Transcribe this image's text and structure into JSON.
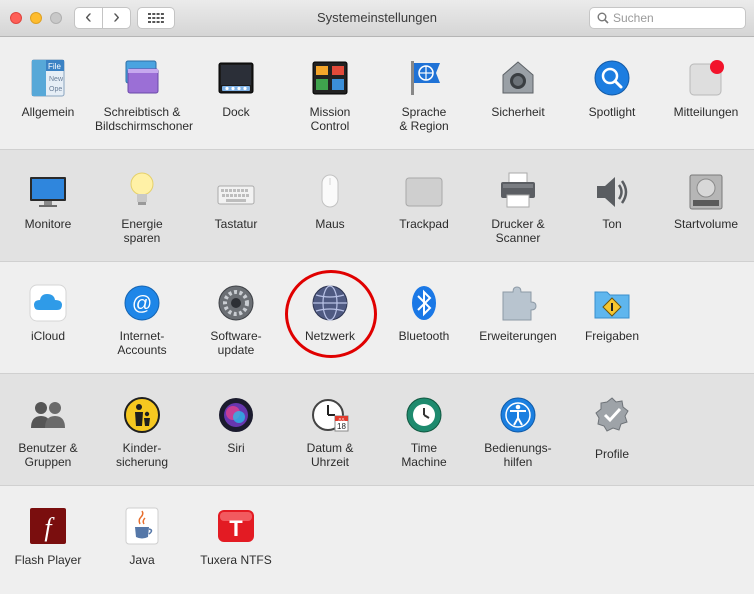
{
  "window": {
    "title": "Systemeinstellungen"
  },
  "toolbar": {
    "back_glyph": "‹",
    "forward_glyph": "›",
    "search_placeholder": "Suchen"
  },
  "rows": [
    [
      {
        "label": "Allgemein",
        "icon": "general-icon"
      },
      {
        "label": "Schreibtisch &\nBildschirmschoner",
        "icon": "desktop-icon"
      },
      {
        "label": "Dock",
        "icon": "dock-icon"
      },
      {
        "label": "Mission\nControl",
        "icon": "mission-control-icon"
      },
      {
        "label": "Sprache\n& Region",
        "icon": "language-region-icon"
      },
      {
        "label": "Sicherheit",
        "icon": "security-icon"
      },
      {
        "label": "Spotlight",
        "icon": "spotlight-icon"
      },
      {
        "label": "Mitteilungen",
        "icon": "notifications-icon"
      }
    ],
    [
      {
        "label": "Monitore",
        "icon": "display-icon"
      },
      {
        "label": "Energie\nsparen",
        "icon": "energy-saver-icon"
      },
      {
        "label": "Tastatur",
        "icon": "keyboard-icon"
      },
      {
        "label": "Maus",
        "icon": "mouse-icon"
      },
      {
        "label": "Trackpad",
        "icon": "trackpad-icon"
      },
      {
        "label": "Drucker &\nScanner",
        "icon": "printer-icon"
      },
      {
        "label": "Ton",
        "icon": "sound-icon"
      },
      {
        "label": "Startvolume",
        "icon": "startup-disk-icon"
      }
    ],
    [
      {
        "label": "iCloud",
        "icon": "icloud-icon"
      },
      {
        "label": "Internet-\nAccounts",
        "icon": "internet-accounts-icon"
      },
      {
        "label": "Software-\nupdate",
        "icon": "software-update-icon"
      },
      {
        "label": "Netzwerk",
        "icon": "network-icon"
      },
      {
        "label": "Bluetooth",
        "icon": "bluetooth-icon"
      },
      {
        "label": "Erweiterungen",
        "icon": "extensions-icon"
      },
      {
        "label": "Freigaben",
        "icon": "sharing-icon"
      }
    ],
    [
      {
        "label": "Benutzer &\nGruppen",
        "icon": "users-groups-icon"
      },
      {
        "label": "Kinder-\nsicherung",
        "icon": "parental-controls-icon"
      },
      {
        "label": "Siri",
        "icon": "siri-icon"
      },
      {
        "label": "Datum &\nUhrzeit",
        "icon": "date-time-icon"
      },
      {
        "label": "Time\nMachine",
        "icon": "time-machine-icon"
      },
      {
        "label": "Bedienungs-\nhilfen",
        "icon": "accessibility-icon"
      },
      {
        "label": "Profile",
        "icon": "profiles-icon"
      }
    ],
    [
      {
        "label": "Flash Player",
        "icon": "flash-player-icon"
      },
      {
        "label": "Java",
        "icon": "java-icon"
      },
      {
        "label": "Tuxera NTFS",
        "icon": "tuxera-ntfs-icon"
      }
    ]
  ],
  "icon_text": {
    "general_file": "File",
    "general_new": "New",
    "general_ope": "Ope",
    "calendar_month": "JUL",
    "calendar_day": "18",
    "tuxera_letter": "T",
    "flash_letter": "f",
    "internet_at": "@"
  },
  "colors": {
    "highlight_circle": "#e00000",
    "close": "#fe5f57",
    "minimize": "#febc2e",
    "zoom": "#c8c8c8"
  }
}
